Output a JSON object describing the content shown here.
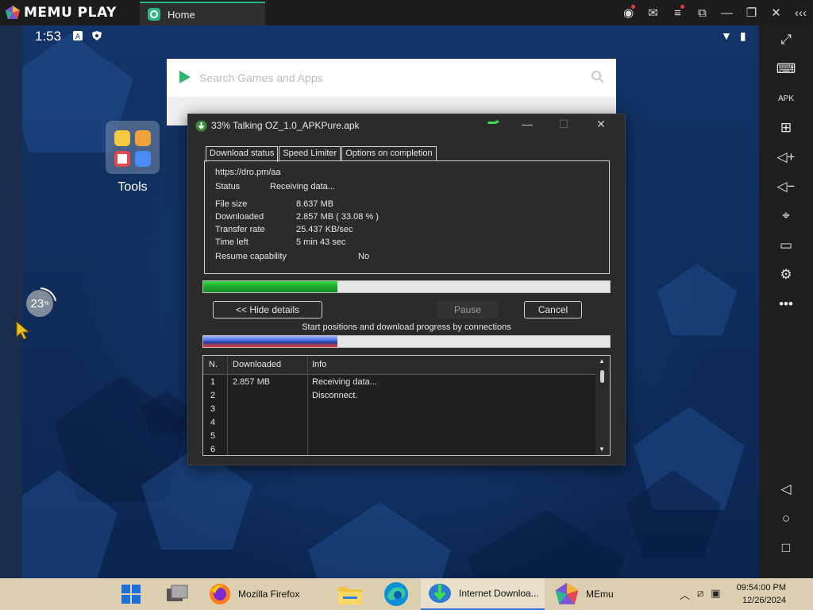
{
  "emulator": {
    "brand": "MEMU PLAY",
    "tab_label": "Home"
  },
  "android": {
    "time": "1:53",
    "search_placeholder": "Search Games and Apps",
    "folder_label": "Tools",
    "battery_percent": "23"
  },
  "dialog": {
    "title": "33% Talking OZ_1.0_APKPure.apk",
    "tabs": [
      "Download status",
      "Speed Limiter",
      "Options on completion"
    ],
    "url": "https://dro.pm/aa",
    "status_label": "Status",
    "status_value": "Receiving data...",
    "rows": [
      {
        "label": "File size",
        "value": "8.637  MB"
      },
      {
        "label": "Downloaded",
        "value": "2.857  MB  ( 33.08 % )"
      },
      {
        "label": "Transfer rate",
        "value": "25.437  KB/sec"
      },
      {
        "label": "Time left",
        "value": "5 min 43 sec"
      }
    ],
    "resume_label": "Resume capability",
    "resume_value": "No",
    "progress_fraction": 0.33,
    "hide_details_label": "<< Hide details",
    "pause_label": "Pause",
    "cancel_label": "Cancel",
    "connections_caption": "Start positions and download progress by connections",
    "connections_progress_fraction": 0.33,
    "table_headers": [
      "N.",
      "Downloaded",
      "Info"
    ],
    "table_rows": [
      {
        "n": "1",
        "downloaded": "2.857 MB",
        "info": "Receiving data..."
      },
      {
        "n": "2",
        "downloaded": "",
        "info": "Disconnect."
      },
      {
        "n": "3",
        "downloaded": "",
        "info": ""
      },
      {
        "n": "4",
        "downloaded": "",
        "info": ""
      },
      {
        "n": "5",
        "downloaded": "",
        "info": ""
      },
      {
        "n": "6",
        "downloaded": "",
        "info": ""
      }
    ]
  },
  "taskbar": {
    "firefox_label": "Mozilla Firefox",
    "idm_label": "Internet Downloa...",
    "memu_label": "MEmu",
    "clock_time": "09:54:00 PM",
    "clock_date": "12/26/2024"
  },
  "colors": {
    "accent_green": "#2fb58c",
    "progress_green": "#1fa82b",
    "connection_blue": "#3d65d6"
  }
}
